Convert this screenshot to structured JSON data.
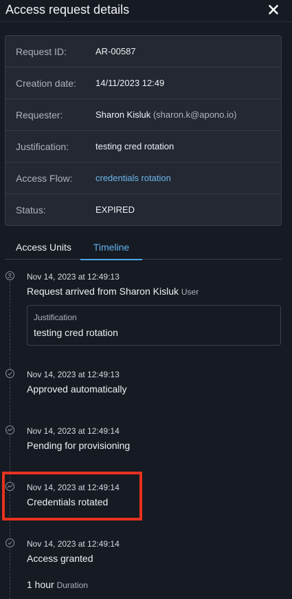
{
  "header": {
    "title": "Access request details"
  },
  "details": {
    "rows": [
      {
        "label": "Request ID:",
        "value": "AR-00587"
      },
      {
        "label": "Creation date:",
        "value": "14/11/2023 12:49"
      },
      {
        "label": "Requester:",
        "value": "Sharon Kisluk",
        "extra": "(sharon.k@apono.io)"
      },
      {
        "label": "Justification:",
        "value": "testing cred rotation"
      },
      {
        "label": "Access Flow:",
        "value": "credentials rotation"
      },
      {
        "label": "Status:",
        "value": "EXPIRED"
      }
    ]
  },
  "tabs": [
    {
      "label": "Access Units",
      "active": false
    },
    {
      "label": "Timeline",
      "active": true
    }
  ],
  "timeline": [
    {
      "icon": "user-icon",
      "time": "Nov 14, 2023 at 12:49:13",
      "text": "Request arrived from Sharon Kisluk",
      "suffix": "User",
      "justification": {
        "label": "Justification",
        "value": "testing cred rotation"
      }
    },
    {
      "icon": "check-circle-icon",
      "time": "Nov 14, 2023 at 12:49:13",
      "text": "Approved automatically"
    },
    {
      "icon": "activity-icon",
      "time": "Nov 14, 2023 at 12:49:14",
      "text": "Pending for provisioning"
    },
    {
      "icon": "activity-icon",
      "time": "Nov 14, 2023 at 12:49:14",
      "text": "Credentials rotated"
    },
    {
      "icon": "check-circle-icon",
      "time": "Nov 14, 2023 at 12:49:14",
      "text": "Access granted",
      "duration": {
        "value": "1 hour",
        "label": "Duration"
      }
    }
  ],
  "colors": {
    "accent": "#4ea8e8",
    "link": "#6fb8ee",
    "highlight": "#e8321f",
    "background": "#161a22"
  }
}
